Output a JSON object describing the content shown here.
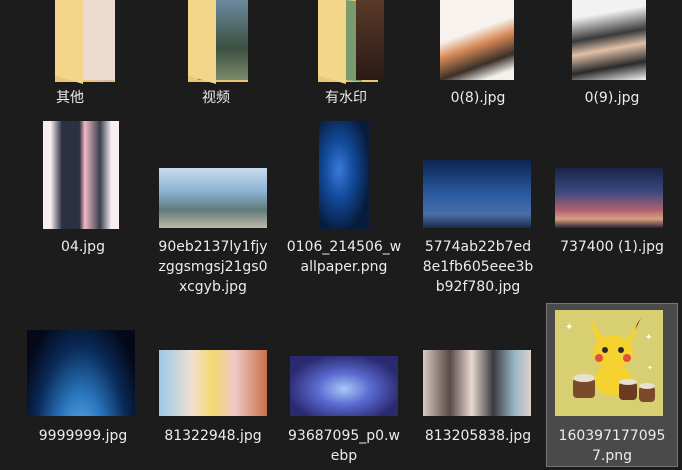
{
  "items": [
    {
      "name": "其他",
      "kind": "folder"
    },
    {
      "name": "视频",
      "kind": "folder"
    },
    {
      "name": "有水印",
      "kind": "folder"
    },
    {
      "name": "0(8).jpg",
      "kind": "image"
    },
    {
      "name": "0(9).jpg",
      "kind": "image"
    },
    {
      "name": "04.jpg",
      "kind": "image"
    },
    {
      "name": "90eb2137ly1fjy\nzggsmgsj21gs0\nxcgyb.jpg",
      "kind": "image"
    },
    {
      "name": "0106_214506_w\nallpaper.png",
      "kind": "image"
    },
    {
      "name": "5774ab22b7ed\n8e1fb605eee3b\nb92f780.jpg",
      "kind": "image"
    },
    {
      "name": "737400 (1).jpg",
      "kind": "image"
    },
    {
      "name": "9999999.jpg",
      "kind": "image"
    },
    {
      "name": "81322948.jpg",
      "kind": "image"
    },
    {
      "name": "93687095_p0.w\nebp",
      "kind": "image"
    },
    {
      "name": "813205838.jpg",
      "kind": "image"
    },
    {
      "name": "160397177095\n7.png",
      "kind": "image",
      "selected": true
    }
  ],
  "colors": {
    "background": "#1c1c1c",
    "text": "#ececec",
    "selection": "#4a4a4a",
    "folder": "#e9c871"
  }
}
